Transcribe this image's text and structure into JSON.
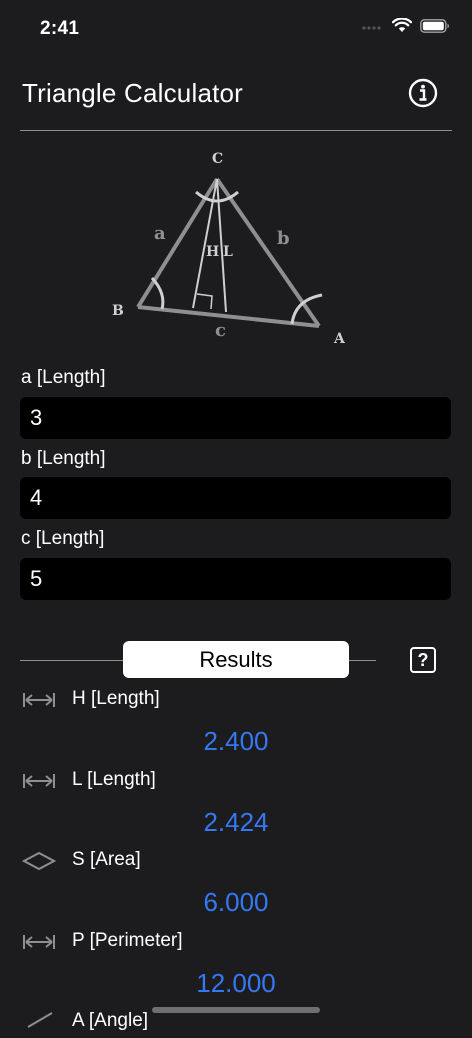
{
  "status": {
    "time": "2:41"
  },
  "header": {
    "title": "Triangle Calculator"
  },
  "diagram": {
    "vertex_a": "A",
    "vertex_b": "B",
    "vertex_c": "C",
    "side_a": "a",
    "side_b": "b",
    "side_c": "c",
    "height": "H",
    "bisector": "L"
  },
  "inputs": [
    {
      "label": "a [Length]",
      "value": "3"
    },
    {
      "label": "b [Length]",
      "value": "4"
    },
    {
      "label": "c [Length]",
      "value": "5"
    }
  ],
  "results": {
    "title": "Results",
    "help": "?",
    "items": [
      {
        "icon": "length-arrows-icon",
        "label": "H [Length]",
        "value": "2.400"
      },
      {
        "icon": "length-arrows-icon",
        "label": "L [Length]",
        "value": "2.424"
      },
      {
        "icon": "diamond-area-icon",
        "label": "S [Area]",
        "value": "6.000"
      },
      {
        "icon": "length-arrows-icon",
        "label": "P [Perimeter]",
        "value": "12.000"
      },
      {
        "icon": "angle-icon",
        "label": "A [Angle]"
      }
    ]
  },
  "colors": {
    "background": "#1c1c1e",
    "accent": "#3478f6",
    "field": "#000000"
  }
}
